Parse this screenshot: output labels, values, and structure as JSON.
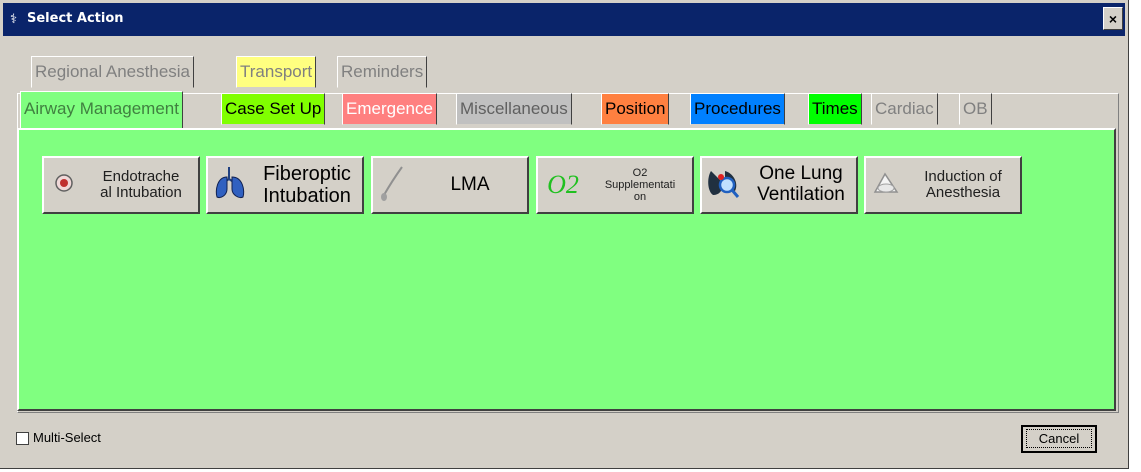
{
  "window": {
    "title": "Select Action",
    "close_label": "×"
  },
  "tabs_row1": [
    {
      "label": "Regional Anesthesia",
      "bg": "#d4d0c8",
      "color": "#808080"
    },
    {
      "label": "Transport",
      "bg": "#ffff80",
      "color": "#808080"
    },
    {
      "label": "Reminders",
      "bg": "#d4d0c8",
      "color": "#808080"
    }
  ],
  "tabs_row2": [
    {
      "label": "Airway Management",
      "bg": "#80ff80",
      "color": "#408040",
      "active": true
    },
    {
      "label": "Case Set Up",
      "bg": "#80ff00",
      "color": "#000000"
    },
    {
      "label": "Emergence",
      "bg": "#ff8080",
      "color": "#ffffff"
    },
    {
      "label": "Miscellaneous",
      "bg": "#c0c0c0",
      "color": "#606060"
    },
    {
      "label": "Position",
      "bg": "#ff8040",
      "color": "#000000"
    },
    {
      "label": "Procedures",
      "bg": "#0080ff",
      "color": "#000000"
    },
    {
      "label": "Times",
      "bg": "#00ff00",
      "color": "#000000"
    },
    {
      "label": "Cardiac",
      "bg": "#d4d0c8",
      "color": "#808080"
    },
    {
      "label": "OB",
      "bg": "#d4d0c8",
      "color": "#808080"
    }
  ],
  "actions": [
    {
      "line1": "Endotrache",
      "line2": "al Intubation",
      "icon": "gauge-icon"
    },
    {
      "line1": "Fiberoptic",
      "line2": "Intubation",
      "icon": "lungs-icon"
    },
    {
      "line1": "LMA",
      "line2": "",
      "icon": "lma-device-icon"
    },
    {
      "line1": "O2",
      "line2": "Supplementati",
      "line3": "on",
      "icon": "o2-icon",
      "icon_text": "O2"
    },
    {
      "line1": "One Lung",
      "line2": "Ventilation",
      "icon": "lung-magnifier-icon"
    },
    {
      "line1": "Induction of",
      "line2": "Anesthesia",
      "icon": "mask-icon"
    }
  ],
  "footer": {
    "multi_select": "Multi-Select",
    "cancel": "Cancel"
  }
}
